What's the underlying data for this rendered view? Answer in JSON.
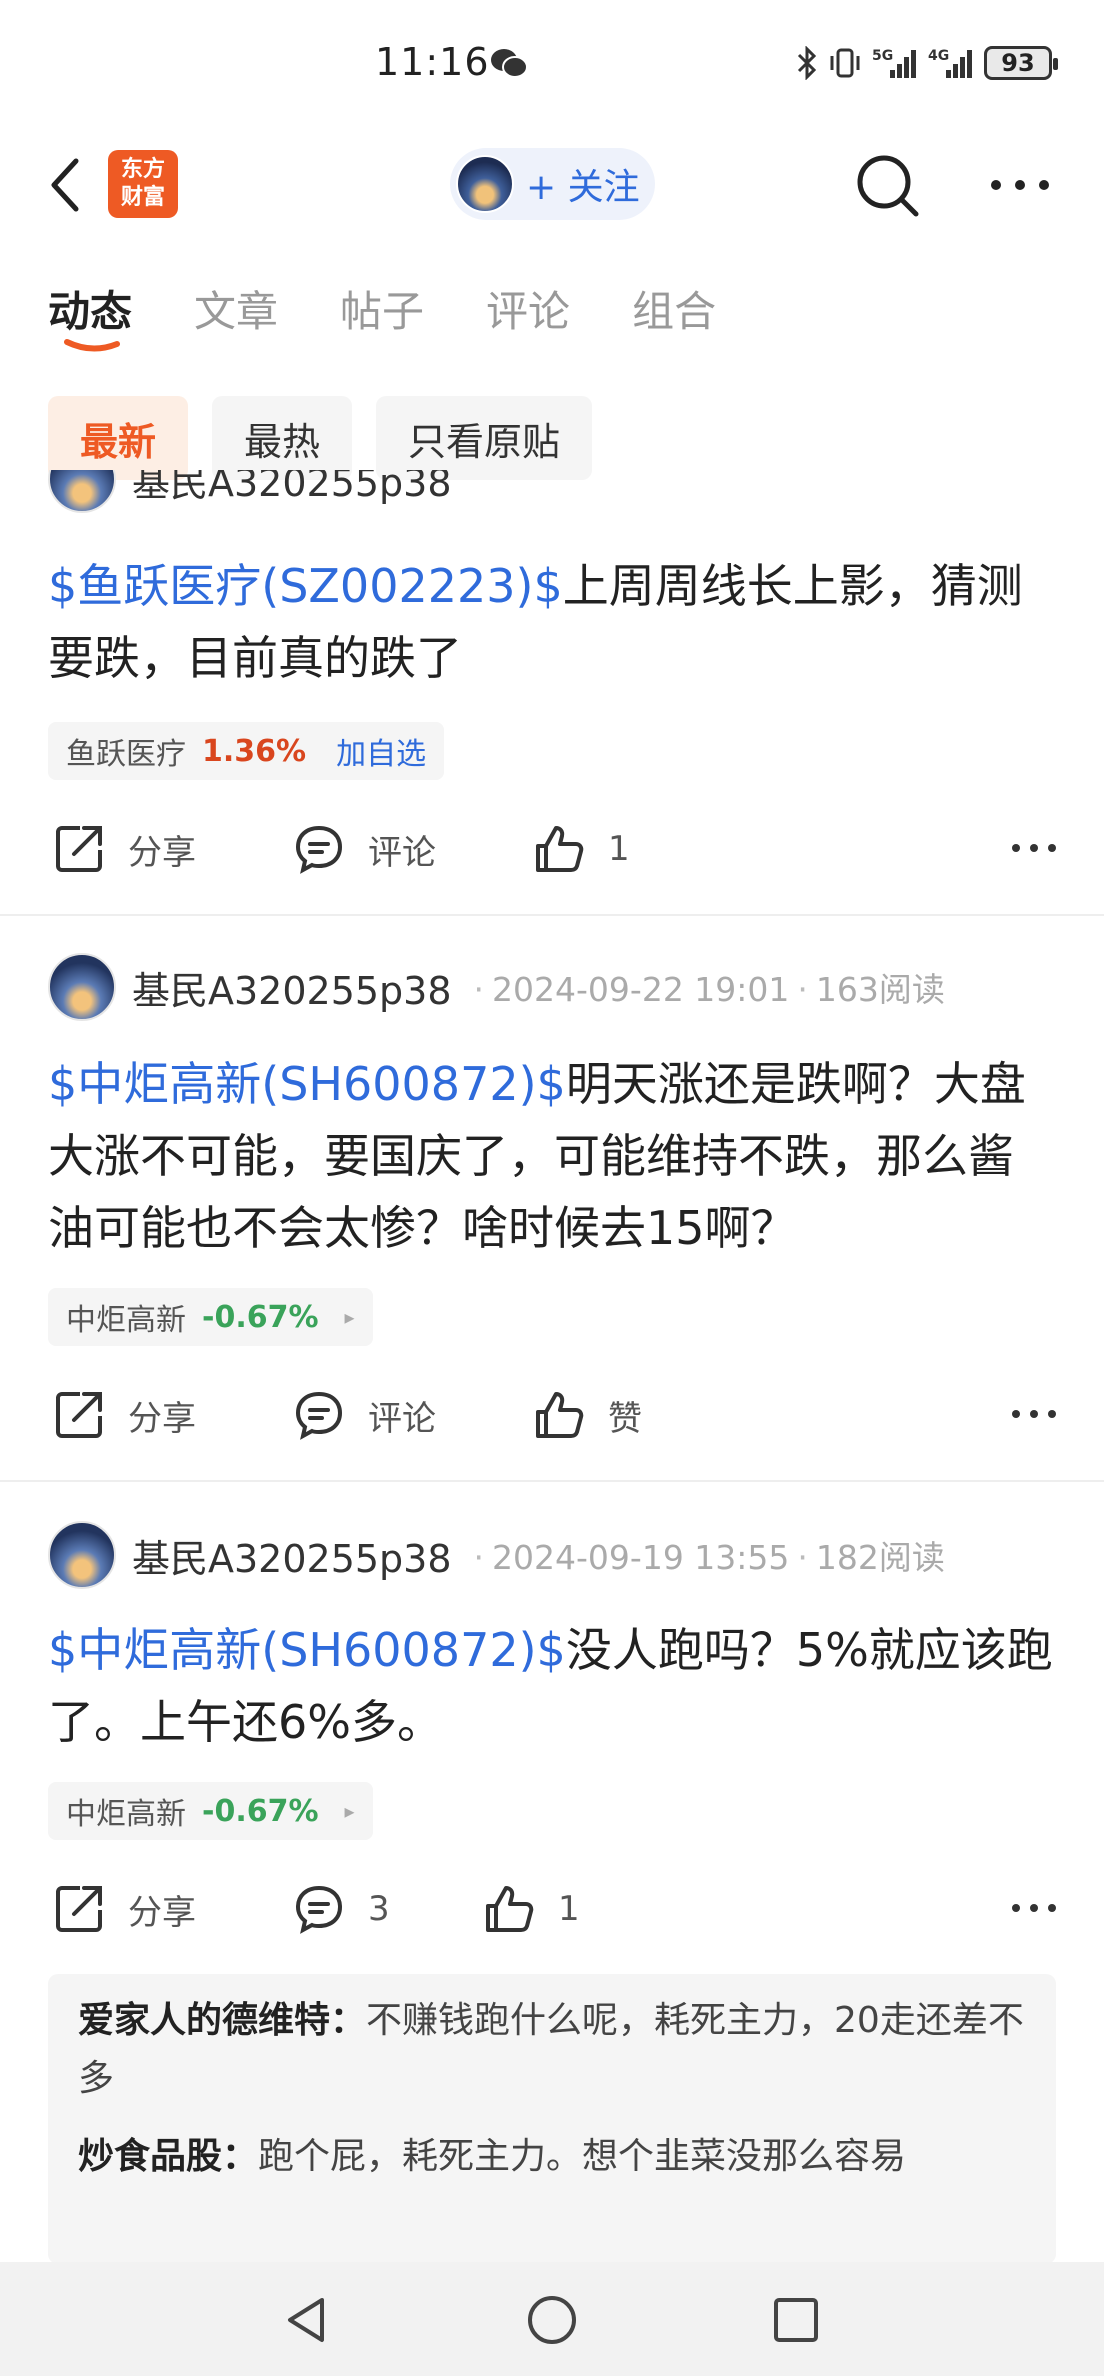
{
  "status_bar": {
    "time": "11:16",
    "battery": "93",
    "icons": [
      "wechat-icon",
      "bluetooth-icon",
      "vibrate-icon",
      "5g-signal-icon",
      "4g-signal-icon",
      "battery-icon"
    ]
  },
  "header": {
    "logo_line1": "东方",
    "logo_line2": "财富",
    "follow_label": "+ 关注",
    "icons": [
      "back-icon",
      "search-icon",
      "more-icon"
    ]
  },
  "tabs": [
    {
      "label": "动态",
      "active": true
    },
    {
      "label": "文章",
      "active": false
    },
    {
      "label": "帖子",
      "active": false
    },
    {
      "label": "评论",
      "active": false
    },
    {
      "label": "组合",
      "active": false
    }
  ],
  "filters": [
    {
      "label": "最新",
      "active": true
    },
    {
      "label": "最热",
      "active": false
    },
    {
      "label": "只看原贴",
      "active": false
    }
  ],
  "posts": [
    {
      "author": "基民A320255p38",
      "stock": "$鱼跃医疗(SZ002223)$",
      "text": "上周周线长上影，猜测要跌，目前真的跌了",
      "chip_name": "鱼跃医疗",
      "chip_pct": "1.36%",
      "chip_add": "加自选",
      "share": "分享",
      "comment": "评论",
      "like": "1"
    },
    {
      "author": "基民A320255p38",
      "datetime": "2024-09-22 19:01",
      "reads": "163阅读",
      "stock": "$中炬高新(SH600872)$",
      "text": "明天涨还是跌啊？大盘大涨不可能，要国庆了，可能维持不跌，那么酱油可能也不会太惨？啥时候去15啊？",
      "chip_name": "中炬高新",
      "chip_pct": "-0.67%",
      "share": "分享",
      "comment": "评论",
      "like": "赞"
    },
    {
      "author": "基民A320255p38",
      "datetime": "2024-09-19 13:55",
      "reads": "182阅读",
      "stock": "$中炬高新(SH600872)$",
      "text": "没人跑吗？5%就应该跑了。上午还6%多。",
      "chip_name": "中炬高新",
      "chip_pct": "-0.67%",
      "share": "分享",
      "comment": "3",
      "like": "1"
    }
  ],
  "comments": [
    {
      "author": "爱家人的德维特：",
      "text": "不赚钱跑什么呢，耗死主力，20走还差不多"
    },
    {
      "author": "炒食品股：",
      "text": "跑个屁，耗死主力。想个韭菜没那么容易"
    }
  ],
  "nav": {
    "icons": [
      "nav-back-icon",
      "nav-home-icon",
      "nav-recents-icon"
    ]
  }
}
